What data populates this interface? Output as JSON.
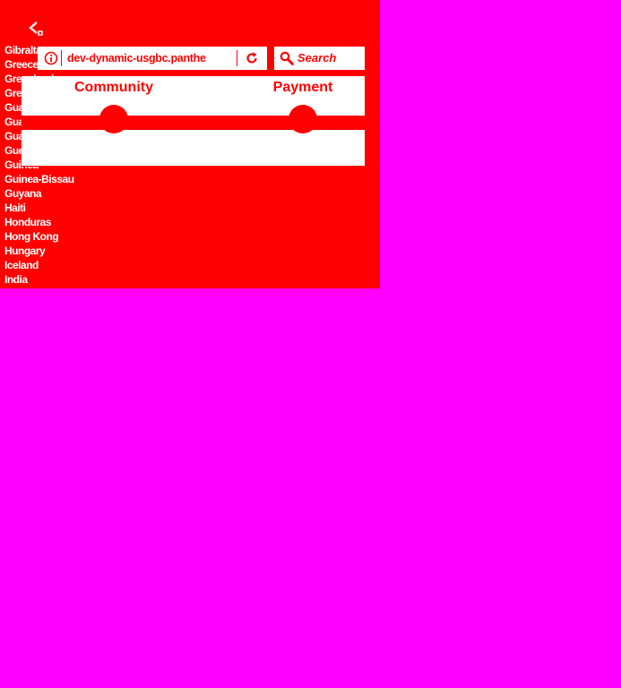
{
  "browser": {
    "url": "dev-dynamic-usgbc.panthe",
    "search_placeholder": "Search",
    "icons": {
      "back": "back-arrow-icon",
      "info": "info-icon",
      "refresh": "refresh-icon",
      "search": "search-icon"
    }
  },
  "country_dropdown": {
    "items": [
      "Gibraltar",
      "Greece",
      "Greenland",
      "Grenada",
      "Guadeloupe",
      "Guam",
      "Guatemala",
      "Guernsey",
      "Guinea",
      "Guinea-Bissau",
      "Guyana",
      "Haiti",
      "Honduras",
      "Hong Kong",
      "Hungary",
      "Iceland",
      "India"
    ]
  },
  "progress": {
    "steps": [
      {
        "label": "Community"
      },
      {
        "label": "Payment"
      }
    ]
  },
  "colors": {
    "accent": "#ff0000",
    "panel": "#ffffff",
    "backdrop": "#ff00ff"
  }
}
